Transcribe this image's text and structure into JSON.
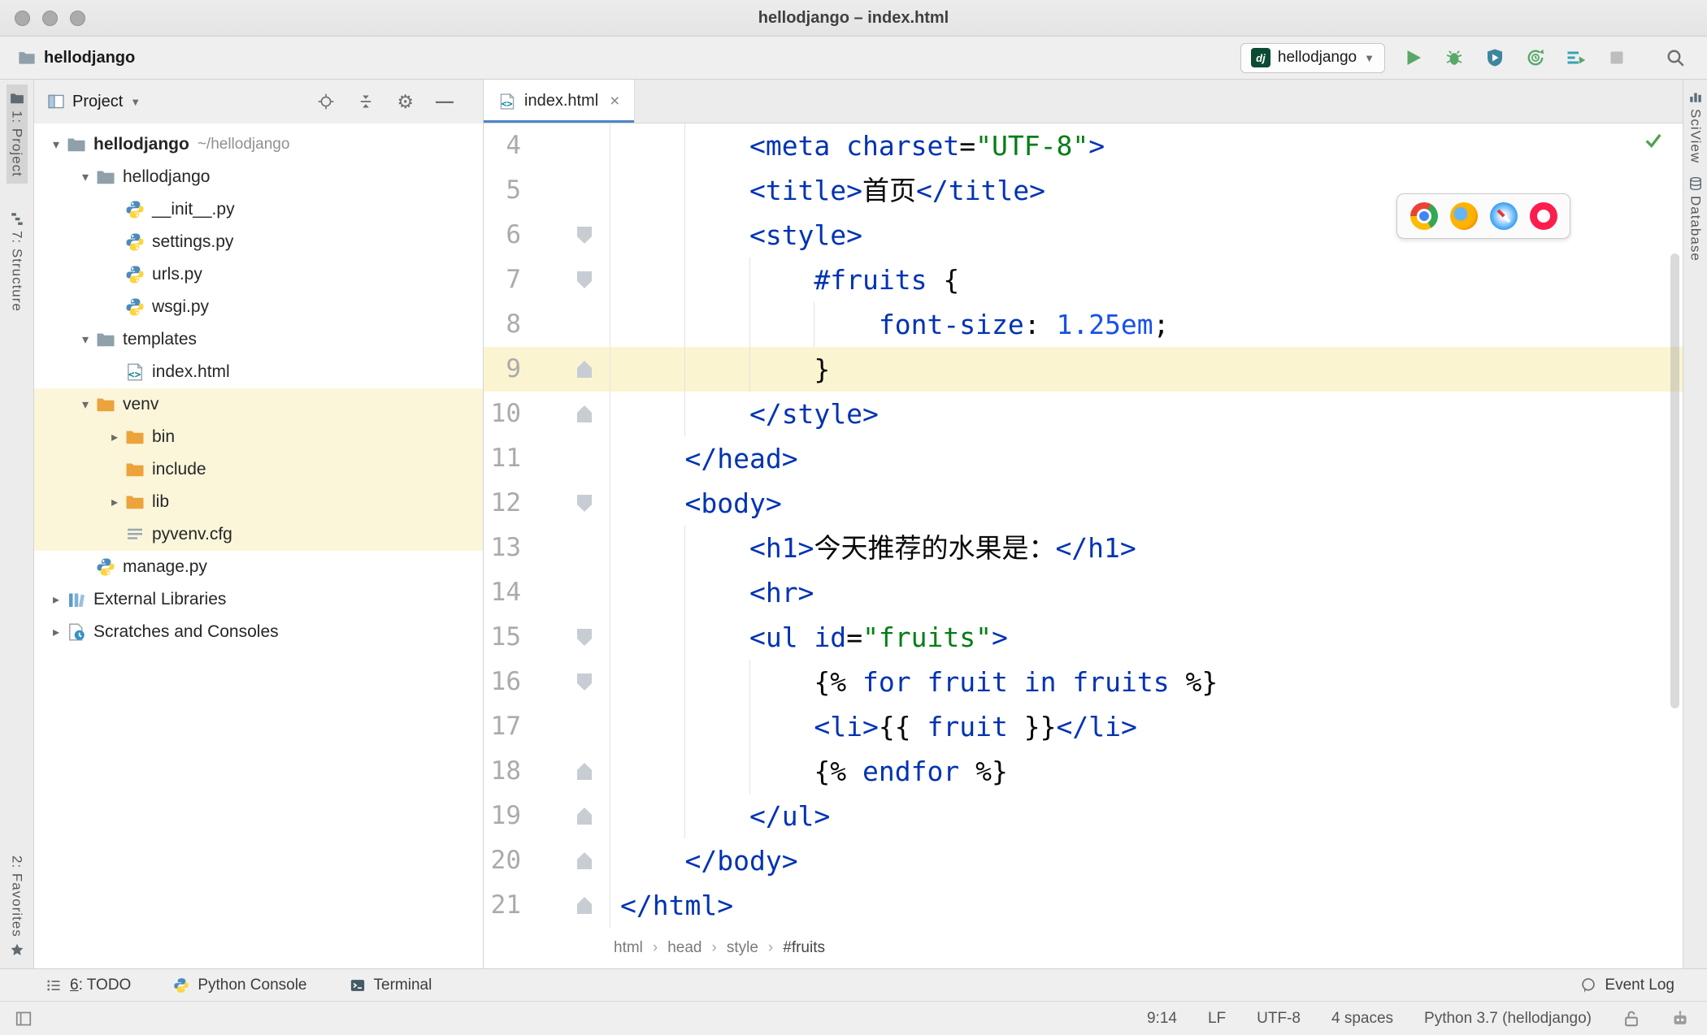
{
  "titlebar": {
    "title": "hellodjango – index.html"
  },
  "toolbar": {
    "breadcrumb": "hellodjango",
    "run_config": "hellodjango",
    "run_config_badge": "dj"
  },
  "left_rail": {
    "items": [
      {
        "label": "1: Project",
        "active": true
      },
      {
        "label": "7: Structure",
        "active": false
      }
    ],
    "bottom": [
      {
        "label": "2: Favorites",
        "active": false
      }
    ]
  },
  "right_rail": [
    {
      "label": "SciView"
    },
    {
      "label": "Database"
    }
  ],
  "project": {
    "title": "Project",
    "tree": [
      {
        "label": "hellodjango",
        "sub": "~/hellodjango",
        "icon": "folder",
        "indent": 0,
        "chevron": "down",
        "bold": true,
        "hl": false
      },
      {
        "label": "hellodjango",
        "icon": "folder",
        "indent": 1,
        "chevron": "down",
        "hl": false
      },
      {
        "label": "__init__.py",
        "icon": "py",
        "indent": 2,
        "chevron": "",
        "hl": false
      },
      {
        "label": "settings.py",
        "icon": "py",
        "indent": 2,
        "chevron": "",
        "hl": false
      },
      {
        "label": "urls.py",
        "icon": "py",
        "indent": 2,
        "chevron": "",
        "hl": false
      },
      {
        "label": "wsgi.py",
        "icon": "py",
        "indent": 2,
        "chevron": "",
        "hl": false
      },
      {
        "label": "templates",
        "icon": "folder",
        "indent": 1,
        "chevron": "down",
        "hl": false
      },
      {
        "label": "index.html",
        "icon": "html",
        "indent": 2,
        "chevron": "",
        "hl": false
      },
      {
        "label": "venv",
        "icon": "folder-ex",
        "indent": 1,
        "chevron": "down",
        "hl": true
      },
      {
        "label": "bin",
        "icon": "folder-ex",
        "indent": 2,
        "chevron": "right",
        "hl": true
      },
      {
        "label": "include",
        "icon": "folder-ex",
        "indent": 2,
        "chevron": "",
        "hl": true
      },
      {
        "label": "lib",
        "icon": "folder-ex",
        "indent": 2,
        "chevron": "right",
        "hl": true
      },
      {
        "label": "pyvenv.cfg",
        "icon": "cfg",
        "indent": 2,
        "chevron": "",
        "hl": true
      },
      {
        "label": "manage.py",
        "icon": "py",
        "indent": 1,
        "chevron": "",
        "hl": false
      },
      {
        "label": "External Libraries",
        "icon": "libs",
        "indent": 0,
        "chevron": "right",
        "hl": false
      },
      {
        "label": "Scratches and Consoles",
        "icon": "scratch",
        "indent": 0,
        "chevron": "right",
        "hl": false
      }
    ]
  },
  "editor": {
    "tab": {
      "label": "index.html"
    },
    "breadcrumbs": [
      "html",
      "head",
      "style",
      "#fruits"
    ],
    "lines": [
      {
        "n": 4,
        "fold": "",
        "cur": false,
        "segs": [
          [
            "        ",
            "p"
          ],
          [
            "<meta ",
            "t"
          ],
          [
            "charset",
            "t"
          ],
          [
            "=",
            "p"
          ],
          [
            "\"UTF-8\"",
            "s"
          ],
          [
            ">",
            "t"
          ]
        ]
      },
      {
        "n": 5,
        "fold": "",
        "cur": false,
        "segs": [
          [
            "        ",
            "p"
          ],
          [
            "<title>",
            "t"
          ],
          [
            "首页",
            "p"
          ],
          [
            "</title>",
            "t"
          ]
        ]
      },
      {
        "n": 6,
        "fold": "down",
        "cur": false,
        "segs": [
          [
            "        ",
            "p"
          ],
          [
            "<style>",
            "t"
          ]
        ]
      },
      {
        "n": 7,
        "fold": "down",
        "cur": false,
        "segs": [
          [
            "            ",
            "p"
          ],
          [
            "#fruits",
            "t"
          ],
          [
            " {",
            "p"
          ]
        ]
      },
      {
        "n": 8,
        "fold": "",
        "cur": false,
        "segs": [
          [
            "                ",
            "p"
          ],
          [
            "font-size",
            "t"
          ],
          [
            ": ",
            "p"
          ],
          [
            "1.25em",
            "n"
          ],
          [
            ";",
            "p"
          ]
        ]
      },
      {
        "n": 9,
        "fold": "up",
        "cur": true,
        "segs": [
          [
            "            ",
            "p"
          ],
          [
            "}",
            "p"
          ]
        ]
      },
      {
        "n": 10,
        "fold": "up",
        "cur": false,
        "segs": [
          [
            "        ",
            "p"
          ],
          [
            "</style>",
            "t"
          ]
        ]
      },
      {
        "n": 11,
        "fold": "",
        "cur": false,
        "segs": [
          [
            "    ",
            "p"
          ],
          [
            "</head>",
            "t"
          ]
        ]
      },
      {
        "n": 12,
        "fold": "down",
        "cur": false,
        "segs": [
          [
            "    ",
            "p"
          ],
          [
            "<body>",
            "t"
          ]
        ]
      },
      {
        "n": 13,
        "fold": "",
        "cur": false,
        "segs": [
          [
            "        ",
            "p"
          ],
          [
            "<h1>",
            "t"
          ],
          [
            "今天推荐的水果是：",
            "p"
          ],
          [
            "</h1>",
            "t"
          ]
        ]
      },
      {
        "n": 14,
        "fold": "",
        "cur": false,
        "segs": [
          [
            "        ",
            "p"
          ],
          [
            "<hr>",
            "t"
          ]
        ]
      },
      {
        "n": 15,
        "fold": "down",
        "cur": false,
        "segs": [
          [
            "        ",
            "p"
          ],
          [
            "<ul ",
            "t"
          ],
          [
            "id",
            "t"
          ],
          [
            "=",
            "p"
          ],
          [
            "\"fruits\"",
            "s"
          ],
          [
            ">",
            "t"
          ]
        ]
      },
      {
        "n": 16,
        "fold": "down",
        "cur": false,
        "segs": [
          [
            "            ",
            "p"
          ],
          [
            "{% ",
            "p"
          ],
          [
            "for",
            "t"
          ],
          [
            " ",
            "p"
          ],
          [
            "fruit",
            "t"
          ],
          [
            " ",
            "p"
          ],
          [
            "in",
            "t"
          ],
          [
            " ",
            "p"
          ],
          [
            "fruits",
            "t"
          ],
          [
            " %}",
            "p"
          ]
        ]
      },
      {
        "n": 17,
        "fold": "",
        "cur": false,
        "segs": [
          [
            "            ",
            "p"
          ],
          [
            "<li>",
            "t"
          ],
          [
            "{{ ",
            "p"
          ],
          [
            "fruit",
            "t"
          ],
          [
            " }}",
            "p"
          ],
          [
            "</li>",
            "t"
          ]
        ]
      },
      {
        "n": 18,
        "fold": "up",
        "cur": false,
        "segs": [
          [
            "            ",
            "p"
          ],
          [
            "{% ",
            "p"
          ],
          [
            "endfor",
            "t"
          ],
          [
            " %}",
            "p"
          ]
        ]
      },
      {
        "n": 19,
        "fold": "up",
        "cur": false,
        "segs": [
          [
            "        ",
            "p"
          ],
          [
            "</ul>",
            "t"
          ]
        ]
      },
      {
        "n": 20,
        "fold": "up",
        "cur": false,
        "segs": [
          [
            "    ",
            "p"
          ],
          [
            "</body>",
            "t"
          ]
        ]
      },
      {
        "n": 21,
        "fold": "up",
        "cur": false,
        "segs": [
          [
            "</html>",
            "t"
          ]
        ]
      }
    ]
  },
  "bottom_bar": {
    "left": [
      {
        "icon": "todo",
        "label": "6: TODO",
        "mnemonic": true
      },
      {
        "icon": "python-console",
        "label": "Python Console",
        "mnemonic": false
      },
      {
        "icon": "terminal",
        "label": "Terminal",
        "mnemonic": false
      }
    ],
    "right": {
      "icon": "event-log",
      "label": "Event Log"
    }
  },
  "status_bar": {
    "items": [
      "9:14",
      "LF",
      "UTF-8",
      "4 spaces",
      "Python 3.7 (hellodjango)"
    ]
  },
  "colors": {
    "tag_blue": "#0033B3",
    "string_green": "#067D17",
    "number_blue": "#1750EB",
    "run_green": "#59A869",
    "highlight_yellow": "#FBF6DA",
    "caret_row_yellow": "#FBF4D1",
    "tab_underline": "#4C87C5"
  }
}
